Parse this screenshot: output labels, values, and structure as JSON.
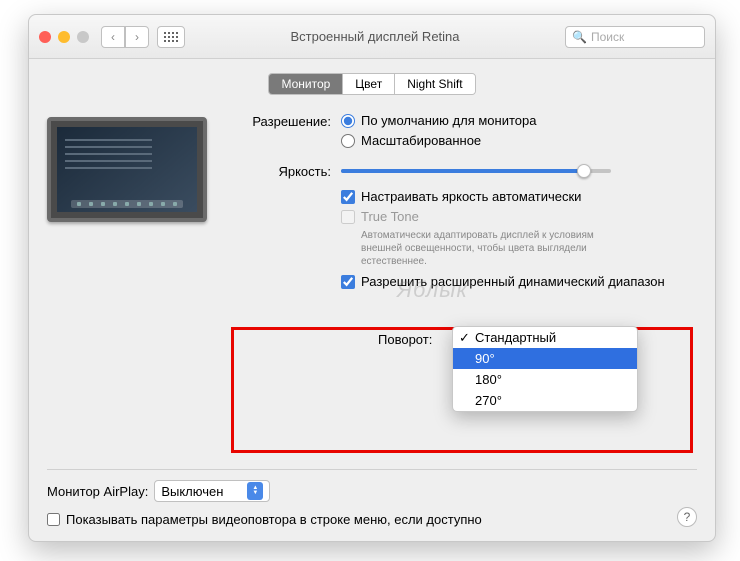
{
  "titlebar": {
    "title": "Встроенный дисплей Retina",
    "search_placeholder": "Поиск"
  },
  "tabs": {
    "monitor": "Монитор",
    "color": "Цвет",
    "nightshift": "Night Shift"
  },
  "labels": {
    "resolution": "Разрешение:",
    "brightness": "Яркость:",
    "rotation": "Поворот:",
    "airplay": "Монитор AirPlay:"
  },
  "resolution": {
    "default": "По умолчанию для монитора",
    "scaled": "Масштабированное"
  },
  "brightness": {
    "auto": "Настраивать яркость автоматически",
    "truetone": "True Tone",
    "truetone_desc": "Автоматически адаптировать дисплей к условиям внешней освещенности, чтобы цвета выглядели естественнее.",
    "hdr": "Разрешить расширенный динамический диапазон"
  },
  "rotation": {
    "options": [
      "Стандартный",
      "90°",
      "180°",
      "270°"
    ]
  },
  "airplay": {
    "value": "Выключен"
  },
  "footer": {
    "mirror": "Показывать параметры видеоповтора в строке меню, если доступно"
  },
  "watermark": "Яблык"
}
